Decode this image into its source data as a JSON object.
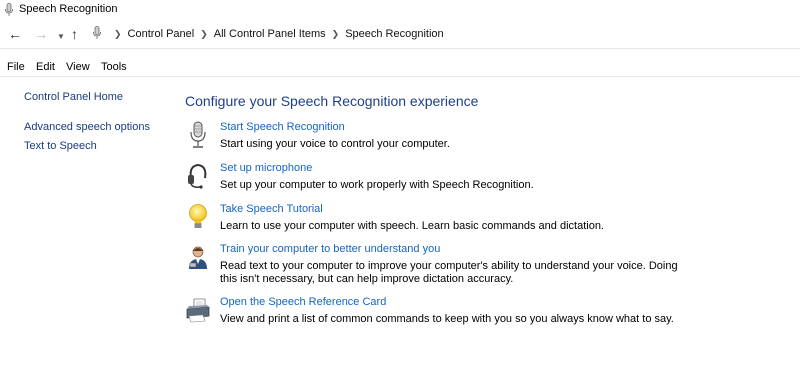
{
  "window": {
    "title": "Speech Recognition"
  },
  "address": {
    "crumbs": [
      "Control Panel",
      "All Control Panel Items",
      "Speech Recognition"
    ]
  },
  "menu": {
    "file": "File",
    "edit": "Edit",
    "view": "View",
    "tools": "Tools"
  },
  "left": {
    "home": "Control Panel Home",
    "advanced": "Advanced speech options",
    "tts": "Text to Speech"
  },
  "main": {
    "heading": "Configure your Speech Recognition experience",
    "tasks": [
      {
        "link": "Start Speech Recognition",
        "desc": "Start using your voice to control your computer.",
        "icon": "microphone-icon"
      },
      {
        "link": "Set up microphone",
        "desc": "Set up your computer to work properly with Speech Recognition.",
        "icon": "headset-icon"
      },
      {
        "link": "Take Speech Tutorial",
        "desc": "Learn to use your computer with speech.  Learn basic commands and dictation.",
        "icon": "lightbulb-icon"
      },
      {
        "link": "Train your computer to better understand you",
        "desc": "Read text to your computer to improve your computer's ability to understand your voice.  Doing this isn't necessary, but can help improve dictation accuracy.",
        "icon": "user-training-icon"
      },
      {
        "link": "Open the Speech Reference Card",
        "desc": "View and print a list of common commands to keep with you so you always know what to say.",
        "icon": "printer-icon"
      }
    ]
  }
}
